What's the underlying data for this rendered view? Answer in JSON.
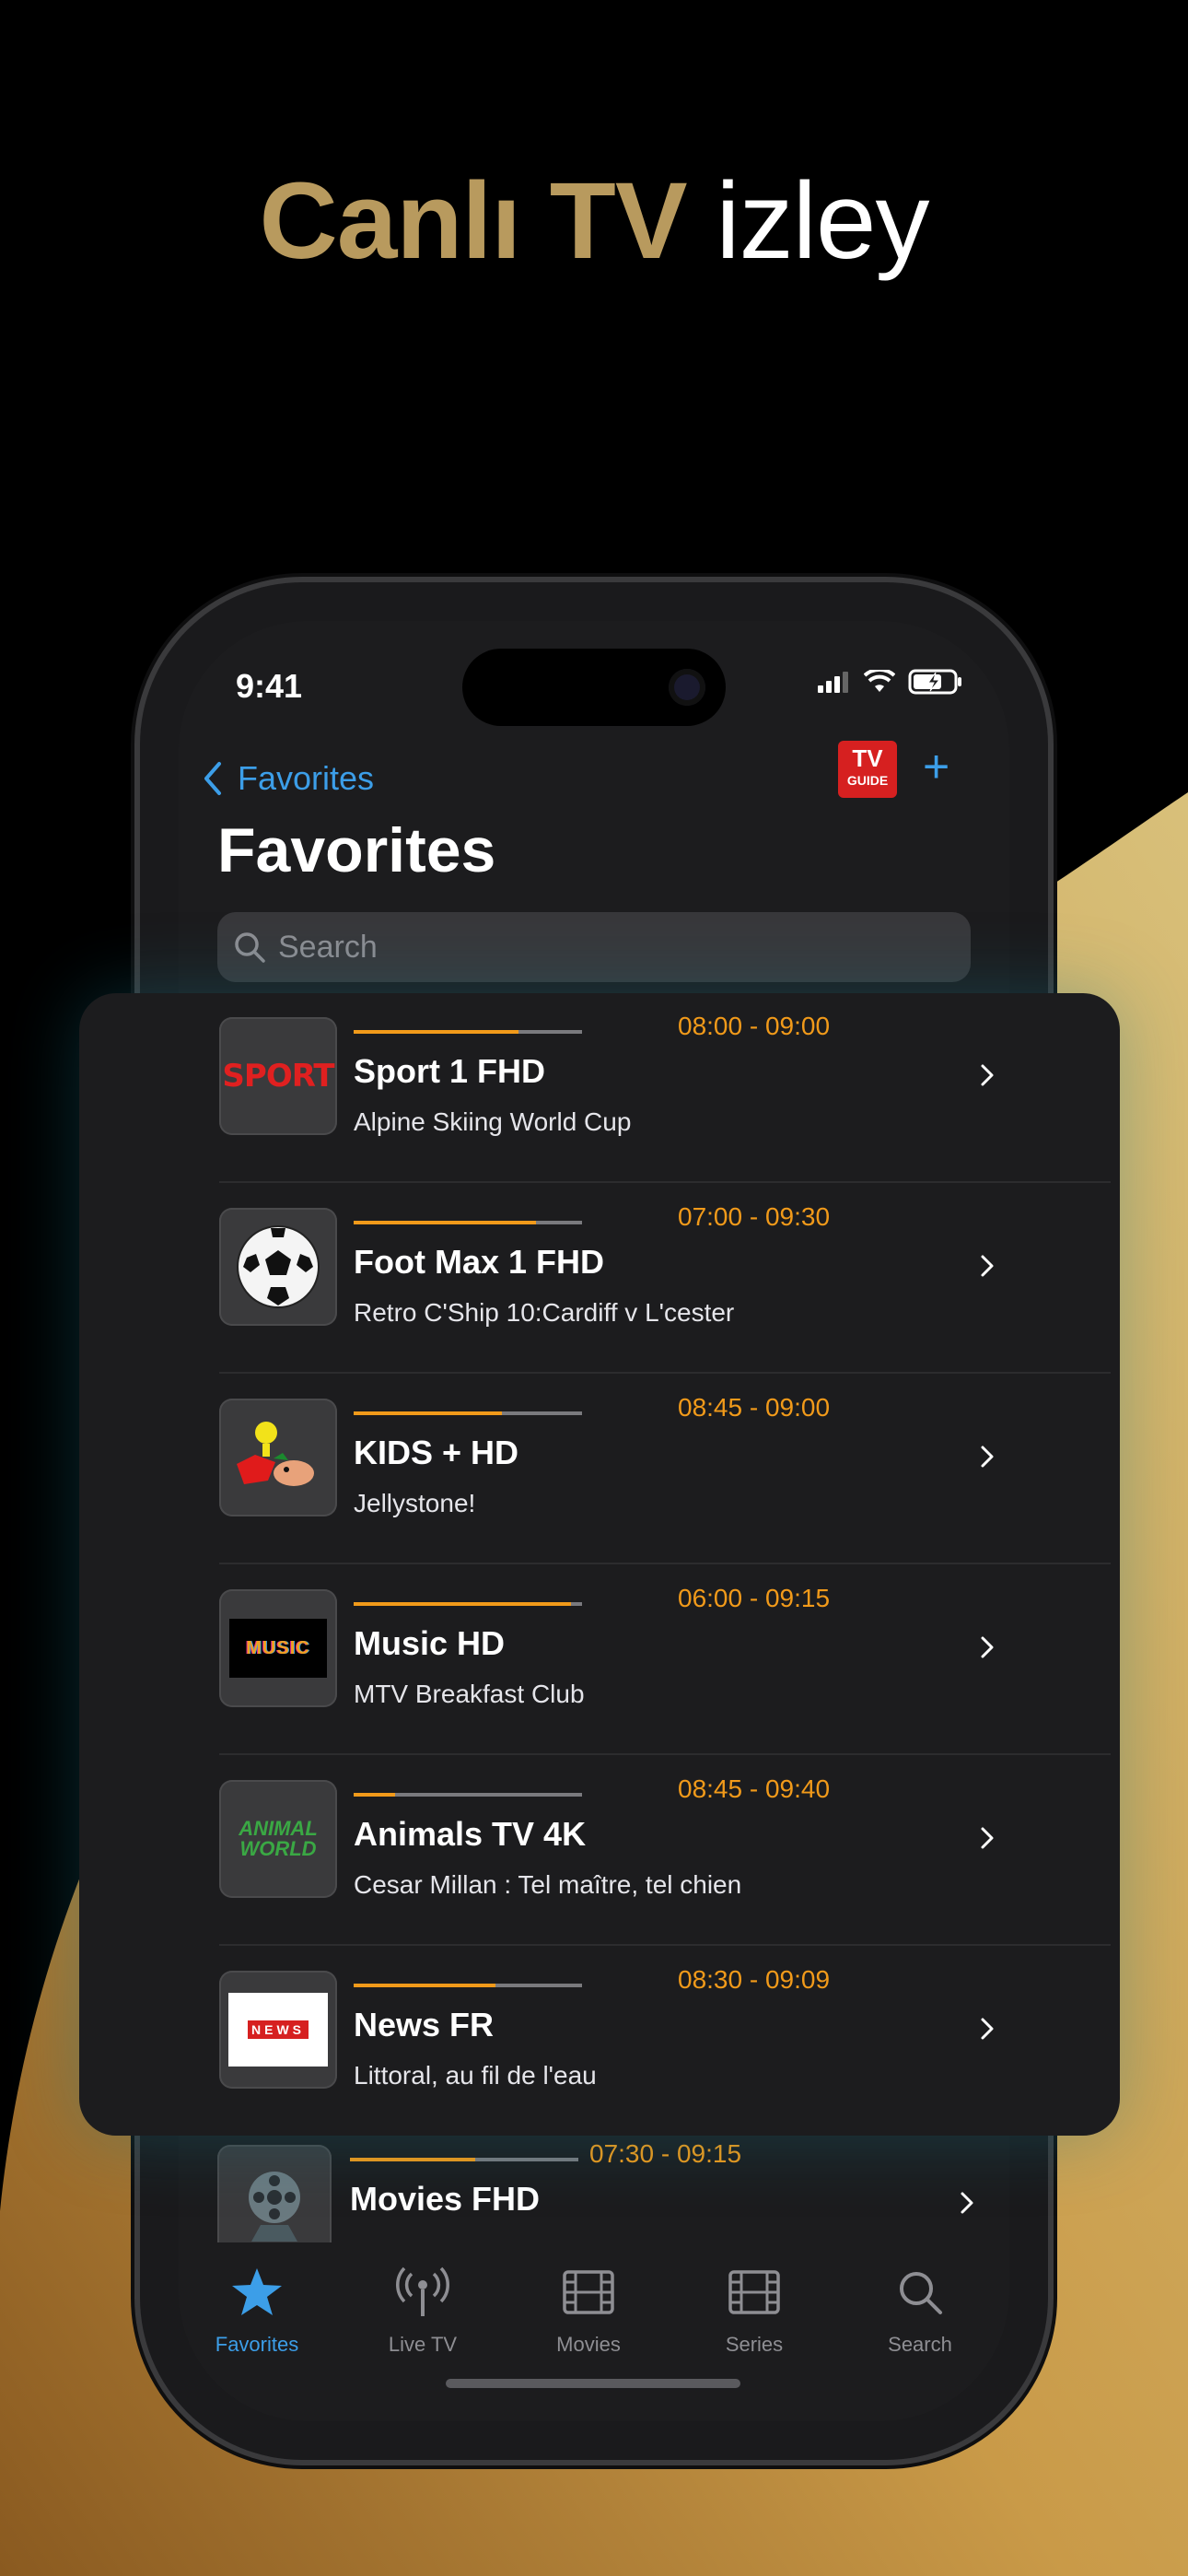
{
  "headline": {
    "bold": "Canlı TV",
    "light": "izley"
  },
  "status_bar": {
    "time": "9:41"
  },
  "nav": {
    "back_label": "Favorites",
    "tvguide_top": "TV",
    "tvguide_bottom": "GUIDE",
    "add_label": "+"
  },
  "page_title": "Favorites",
  "search": {
    "placeholder": "Search"
  },
  "channels": [
    {
      "name": "Sport 1 FHD",
      "time": "08:00 - 09:00",
      "program": "Alpine Skiing World Cup",
      "progress": 0.72,
      "logo_text": "SPORT"
    },
    {
      "name": "Foot Max 1 FHD",
      "time": "07:00 - 09:30",
      "program": "Retro C'Ship 10:Cardiff v L'cester",
      "progress": 0.8
    },
    {
      "name": "KIDS + HD",
      "time": "08:45 - 09:00",
      "program": "Jellystone!",
      "progress": 0.65
    },
    {
      "name": "Music HD",
      "time": "06:00 - 09:15",
      "program": "MTV Breakfast Club",
      "progress": 0.95,
      "logo_text": "MUSIC"
    },
    {
      "name": "Animals TV 4K",
      "time": "08:45 - 09:40",
      "program": "Cesar Millan : Tel maître, tel chien",
      "progress": 0.18,
      "logo_text": "ANIMAL WORLD"
    },
    {
      "name": "News FR",
      "time": "08:30 - 09:09",
      "program": "Littoral, au fil de l'eau",
      "progress": 0.62,
      "logo_text": "NEWS"
    }
  ],
  "partial_channel": {
    "name": "Movies FHD",
    "time": "07:30 - 09:15",
    "progress": 0.55
  },
  "tabs": [
    {
      "label": "Favorites",
      "icon": "star-icon",
      "active": true
    },
    {
      "label": "Live TV",
      "icon": "antenna-icon",
      "active": false
    },
    {
      "label": "Movies",
      "icon": "film-icon",
      "active": false
    },
    {
      "label": "Series",
      "icon": "film-icon",
      "active": false
    },
    {
      "label": "Search",
      "icon": "search-icon",
      "active": false
    }
  ],
  "colors": {
    "accent": "#3c9ee8",
    "progress": "#f19a1a",
    "gold": "#b89a5e",
    "background": "#1c1c1e"
  }
}
